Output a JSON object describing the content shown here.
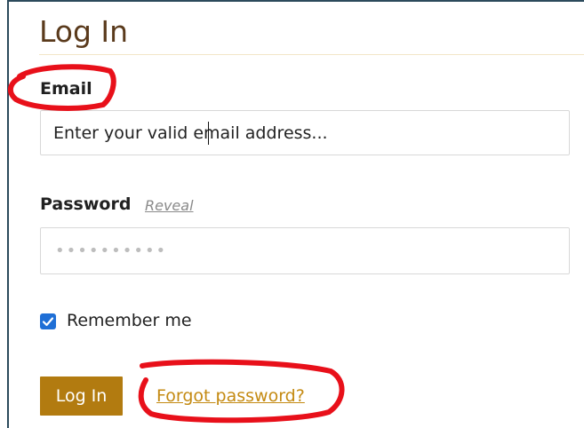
{
  "page": {
    "title": "Log In"
  },
  "form": {
    "email_label": "Email",
    "email_value": "Enter your valid email address...",
    "password_label": "Password",
    "reveal_label": "Reveal",
    "password_masked": "••••••••••",
    "remember_label": "Remember me",
    "remember_checked": true,
    "login_button": "Log In",
    "forgot_link": "Forgot password?"
  },
  "colors": {
    "title": "#5a3a1c",
    "button_bg": "#b27b10",
    "link": "#c48a12",
    "checkbox": "#1f6fd6",
    "annotation": "#e8101a"
  }
}
